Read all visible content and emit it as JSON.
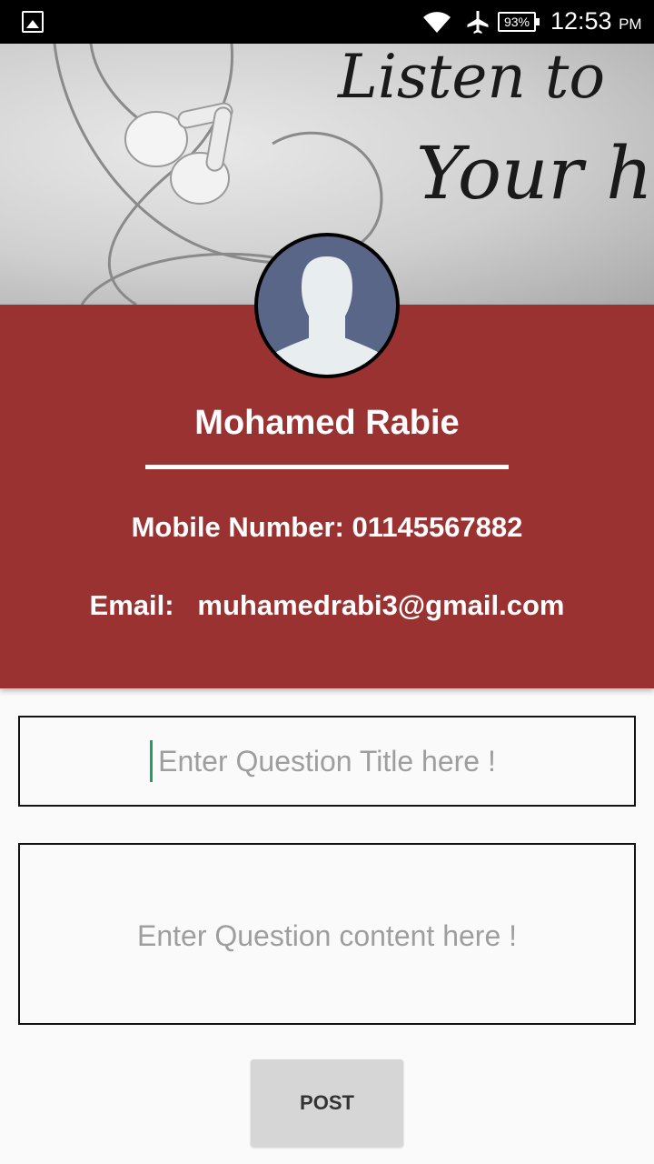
{
  "status_bar": {
    "battery": "93%",
    "time": "12:53",
    "ampm": "PM",
    "icons": [
      "gallery-icon",
      "wifi-icon",
      "airplane-mode-icon",
      "battery-icon"
    ]
  },
  "hero": {
    "line1": "Listen to",
    "line2": "Your hea"
  },
  "profile": {
    "name": "Mohamed Rabie",
    "mobile": "Mobile Number: 01145567882",
    "email": "Email:   muhamedrabi3@gmail.com",
    "panel_color": "#9a3232"
  },
  "form": {
    "title_placeholder": "Enter Question Title here !",
    "content_placeholder": "Enter Question content here !",
    "post_label": "POST"
  }
}
